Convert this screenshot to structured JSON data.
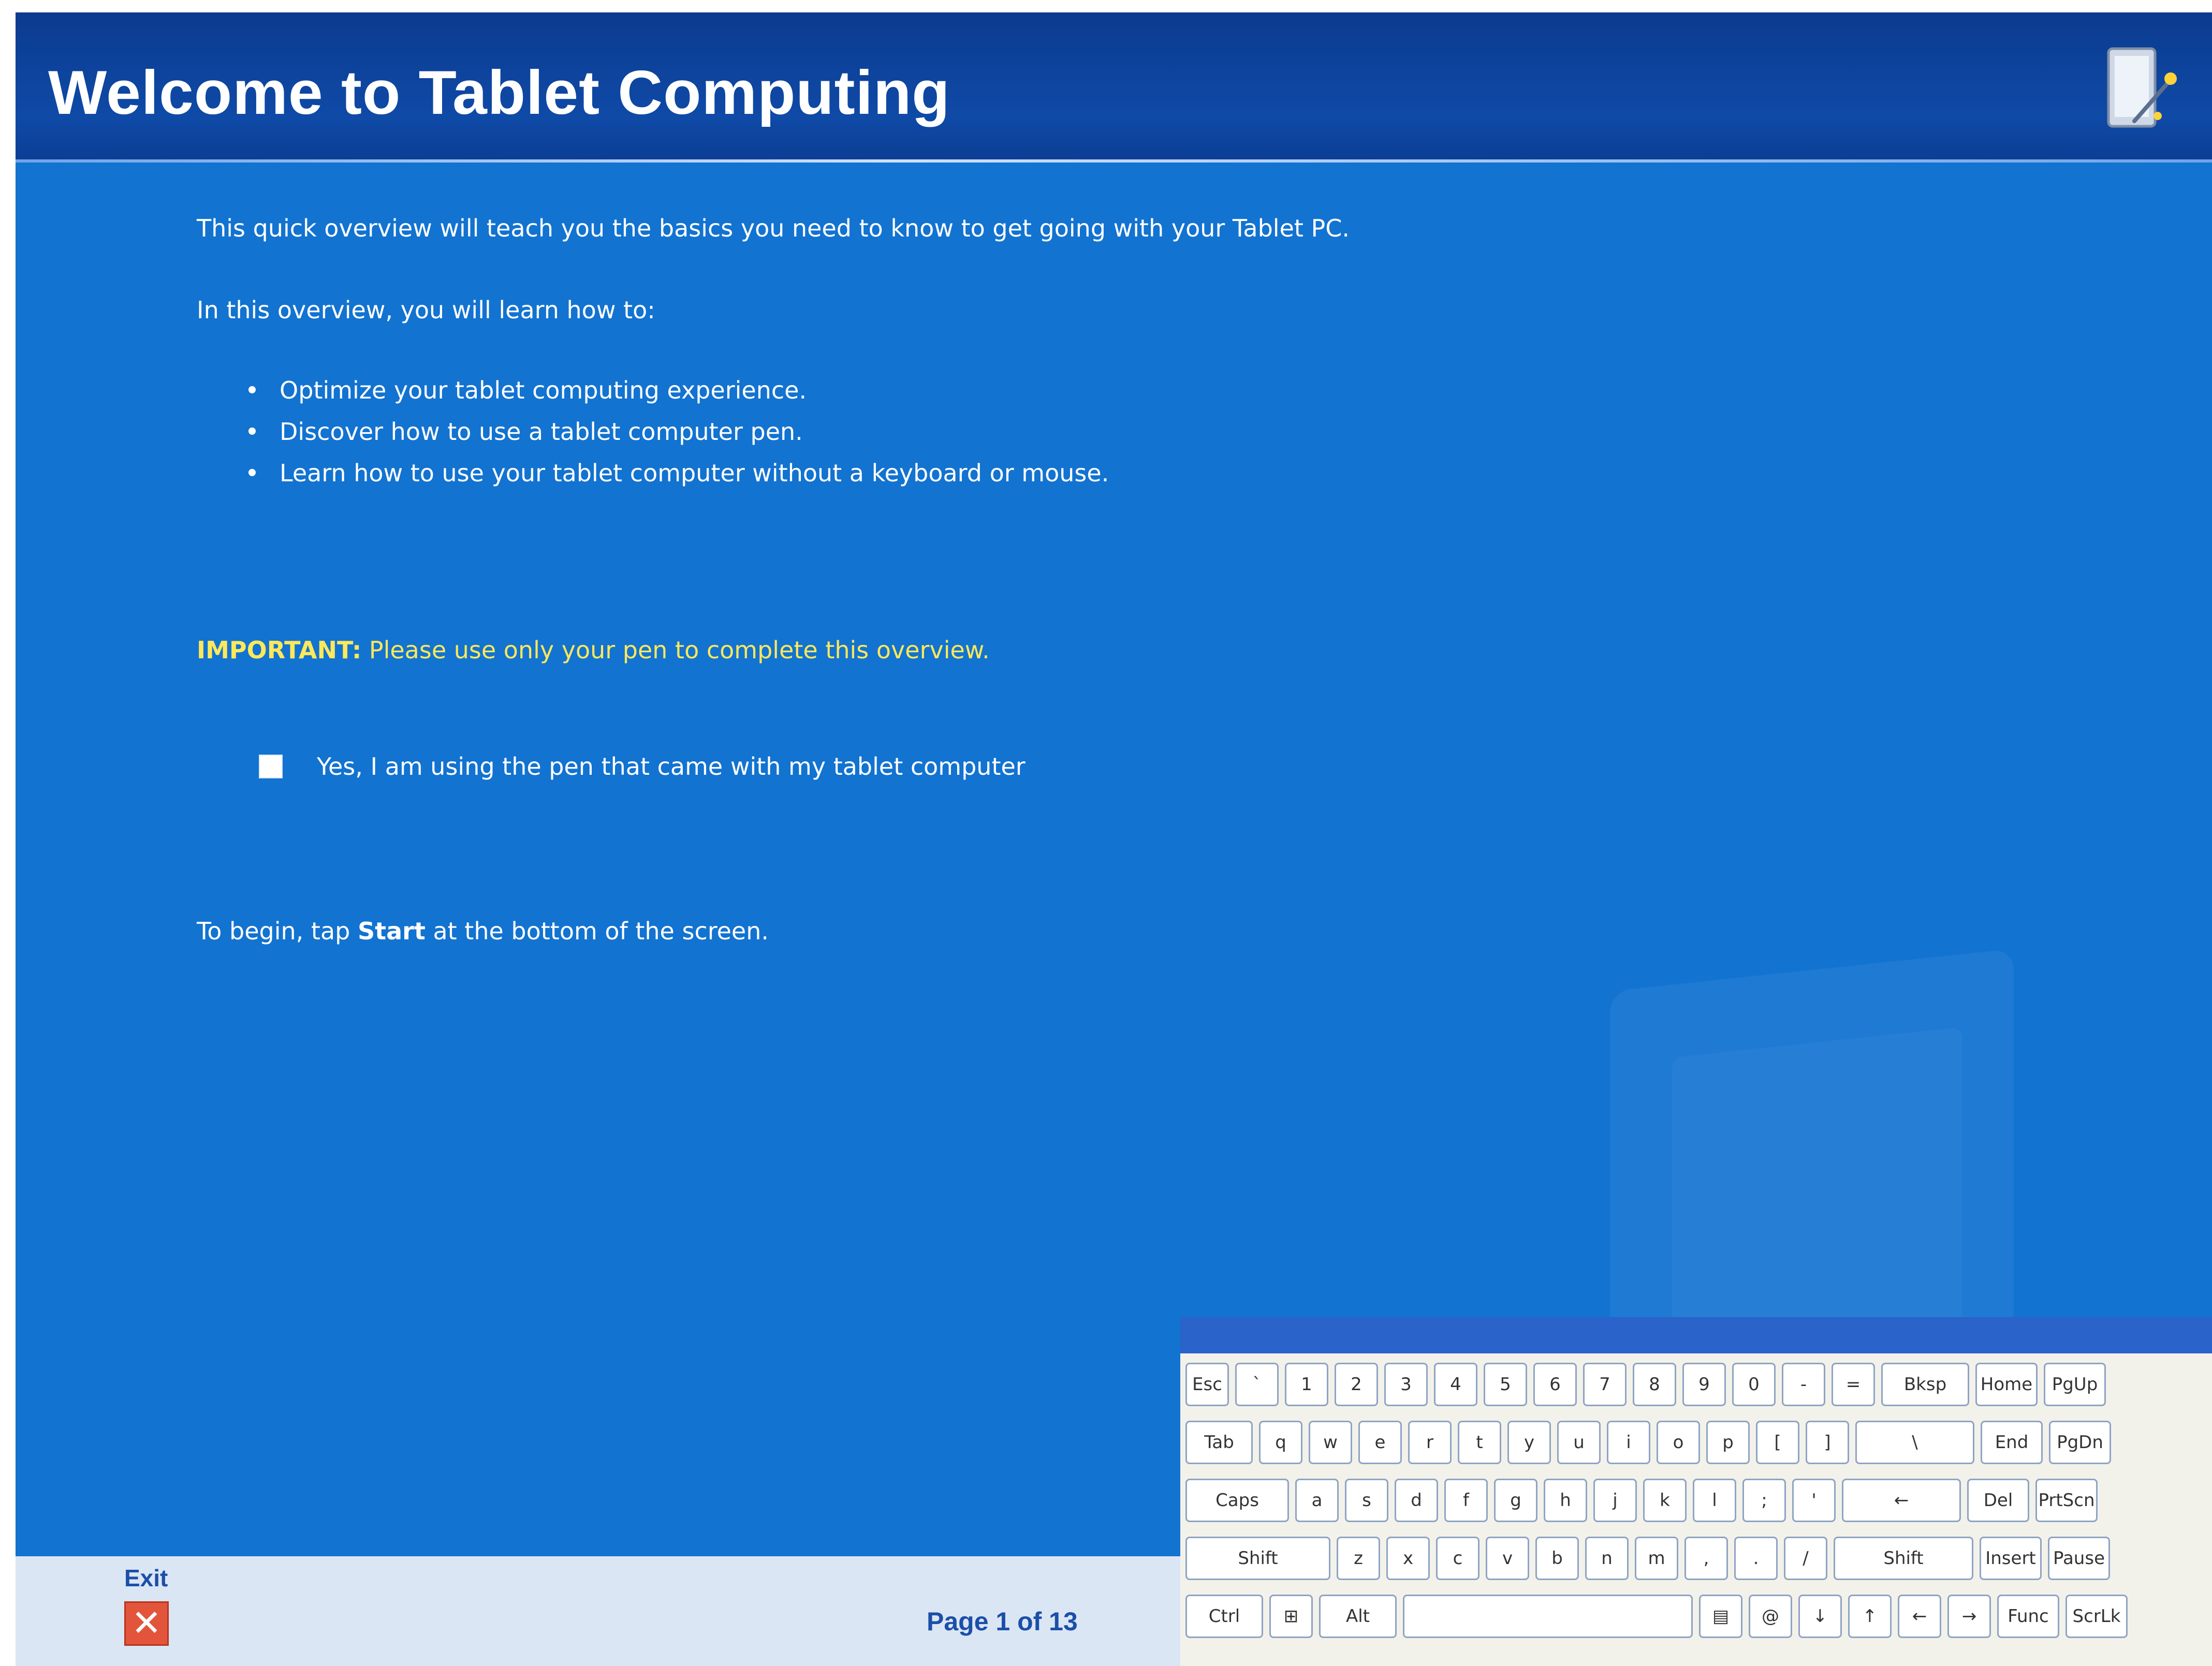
{
  "window": {
    "title": "Welcome to Tablet Computing"
  },
  "content": {
    "intro": "This quick overview will teach you the basics you need to know to get going with your Tablet PC.",
    "lead_in": "In this overview, you will learn how to:",
    "bullets": [
      "Optimize your tablet computing experience.",
      "Discover how to use a tablet computer pen.",
      "Learn how to use your tablet computer without a keyboard or mouse."
    ],
    "important_label": "IMPORTANT:",
    "important_text": "Please use only your pen to complete this overview.",
    "checkbox_label": "Yes, I am using the pen that came with my tablet computer",
    "checkbox_checked": false,
    "begin_prefix": "To begin, tap ",
    "begin_bold": "Start",
    "begin_suffix": " at the bottom of the screen."
  },
  "footer": {
    "exit_label": "Exit",
    "exit_icon": "close-icon",
    "page_indicator": "Page 1 of 13"
  },
  "keyboard": {
    "row1": [
      "Esc",
      "`",
      "1",
      "2",
      "3",
      "4",
      "5",
      "6",
      "7",
      "8",
      "9",
      "0",
      "-",
      "=",
      "Bksp",
      "Home",
      "PgUp"
    ],
    "row2": [
      "Tab",
      "q",
      "w",
      "e",
      "r",
      "t",
      "y",
      "u",
      "i",
      "o",
      "p",
      "[",
      "]",
      "\\",
      "End",
      "PgDn"
    ],
    "row3": [
      "Caps",
      "a",
      "s",
      "d",
      "f",
      "g",
      "h",
      "j",
      "k",
      "l",
      ";",
      "'",
      "←",
      "Del",
      "PrtScn"
    ],
    "row4": [
      "Shift",
      "z",
      "x",
      "c",
      "v",
      "b",
      "n",
      "m",
      ",",
      ".",
      "/",
      "Shift",
      "Insert",
      "Pause"
    ],
    "row5": [
      "Ctrl",
      "⊞",
      "Alt",
      "",
      "▤",
      "@",
      "↓",
      "↑",
      "←",
      "→",
      "Func",
      "ScrLk"
    ]
  },
  "colors": {
    "title_bar": "#0b3b8f",
    "content_bg": "#1273d1",
    "important": "#ffe85a",
    "footer_bg": "#dbe6f5",
    "footer_text": "#1b4fa8"
  }
}
